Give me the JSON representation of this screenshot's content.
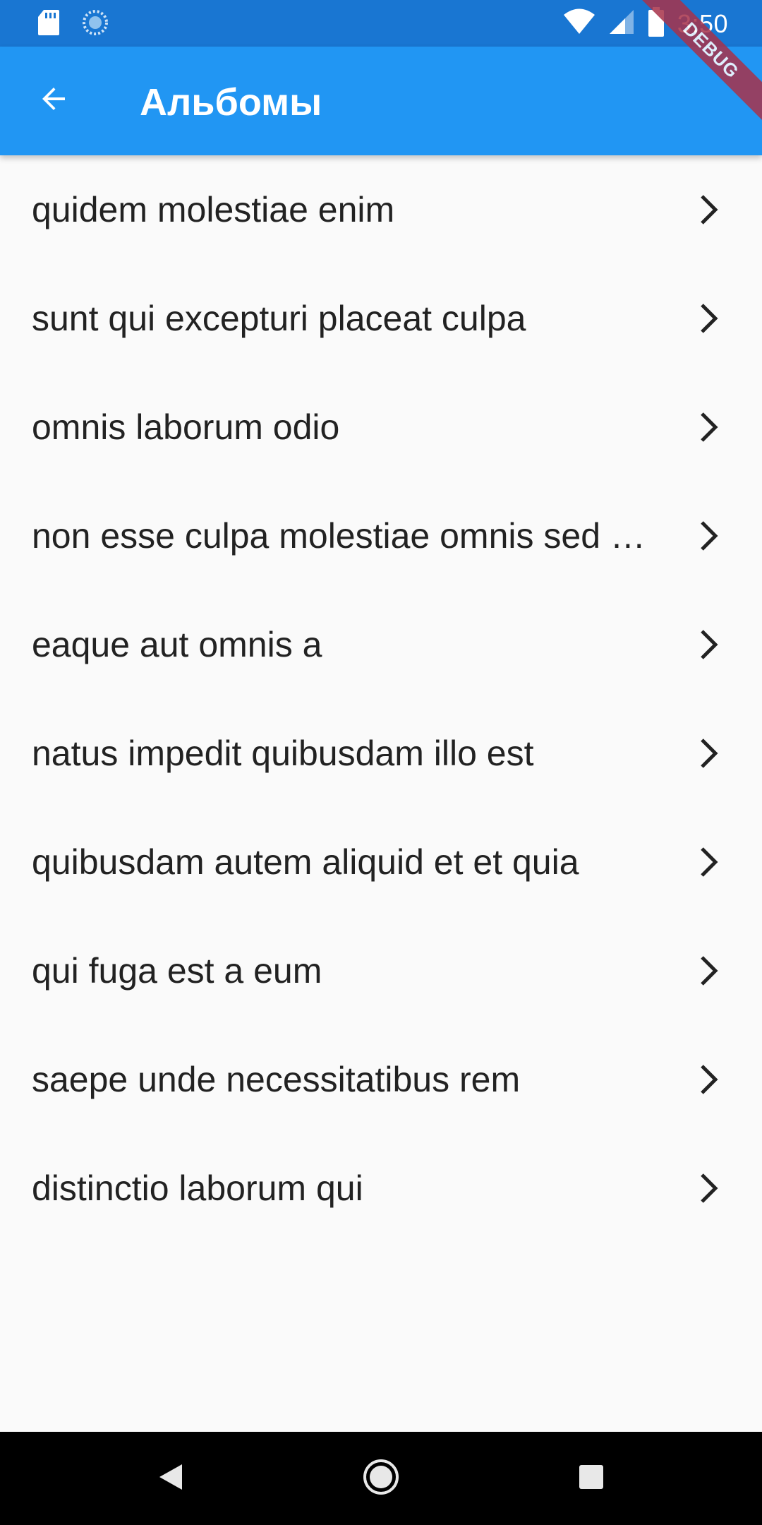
{
  "status_bar": {
    "time": "3:50",
    "left_icons": [
      "sd-card-icon",
      "sync-icon"
    ],
    "right_icons": [
      "wifi-icon",
      "signal-icon",
      "battery-icon"
    ],
    "color": "#1976d2"
  },
  "app_bar": {
    "title": "Альбомы",
    "back_icon": "arrow-back-icon",
    "color": "#2196f3"
  },
  "debug_banner": {
    "label": "DEBUG"
  },
  "albums": [
    {
      "title": "quidem molestiae enim"
    },
    {
      "title": "sunt qui excepturi placeat culpa"
    },
    {
      "title": "omnis laborum odio"
    },
    {
      "title": "non esse culpa molestiae omnis sed optio"
    },
    {
      "title": "eaque aut omnis a"
    },
    {
      "title": "natus impedit quibusdam illo est"
    },
    {
      "title": "quibusdam autem aliquid et et quia"
    },
    {
      "title": "qui fuga est a eum"
    },
    {
      "title": "saepe unde necessitatibus rem"
    },
    {
      "title": "distinctio laborum qui"
    }
  ],
  "nav_bar": {
    "buttons": [
      "back-nav-icon",
      "home-nav-icon",
      "recents-nav-icon"
    ]
  }
}
